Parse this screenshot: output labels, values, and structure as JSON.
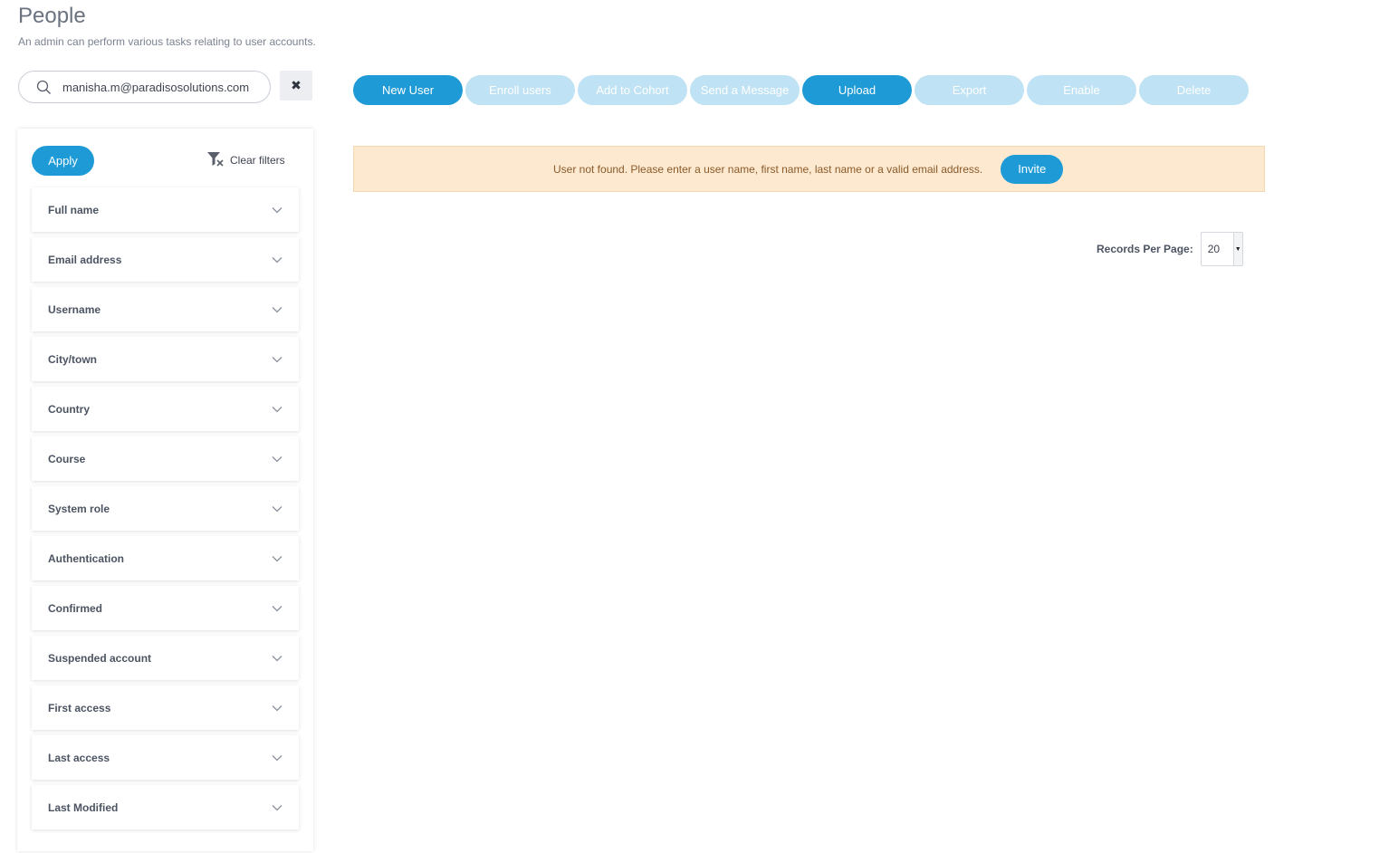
{
  "header": {
    "title": "People",
    "subtitle": "An admin can perform various tasks relating to user accounts."
  },
  "search": {
    "value": "manisha.m@paradisosolutions.com",
    "placeholder": "",
    "clear_label": "✖"
  },
  "toolbar": {
    "buttons": [
      {
        "label": "New User",
        "state": "active"
      },
      {
        "label": "Enroll users",
        "state": "disabled"
      },
      {
        "label": "Add to Cohort",
        "state": "disabled"
      },
      {
        "label": "Send a Message",
        "state": "disabled"
      },
      {
        "label": "Upload",
        "state": "active"
      },
      {
        "label": "Export",
        "state": "disabled"
      },
      {
        "label": "Enable",
        "state": "disabled"
      },
      {
        "label": "Delete",
        "state": "disabled"
      }
    ]
  },
  "filters": {
    "apply_label": "Apply",
    "clear_label": "Clear filters",
    "items": [
      {
        "label": "Full name"
      },
      {
        "label": "Email address"
      },
      {
        "label": "Username"
      },
      {
        "label": "City/town"
      },
      {
        "label": "Country"
      },
      {
        "label": "Course"
      },
      {
        "label": "System role"
      },
      {
        "label": "Authentication"
      },
      {
        "label": "Confirmed"
      },
      {
        "label": "Suspended account"
      },
      {
        "label": "First access"
      },
      {
        "label": "Last access"
      },
      {
        "label": "Last Modified"
      }
    ]
  },
  "alert": {
    "message": "User not found. Please enter a user name, first name, last name or a valid email address.",
    "invite_label": "Invite"
  },
  "pagination": {
    "records_label": "Records Per Page:",
    "records_value": "20"
  },
  "colors": {
    "accent": "#1e9ad6",
    "accent_disabled": "#bfe2f4",
    "alert_bg": "#fde9cf"
  }
}
